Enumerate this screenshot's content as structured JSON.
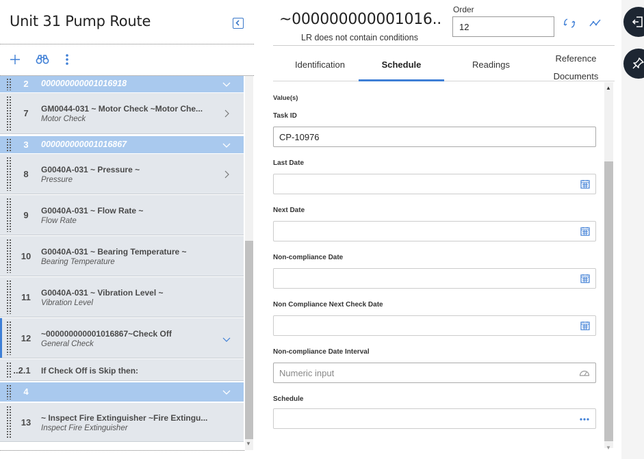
{
  "left": {
    "title": "Unit 31 Pump Route",
    "rows": [
      {
        "kind": "group",
        "num": "2",
        "text": "000000000001016918"
      },
      {
        "kind": "item",
        "num": "7",
        "title": "GM0044-031 ~ Motor Check ~Motor Che...",
        "subtitle": "Motor Check"
      },
      {
        "kind": "group",
        "num": "3",
        "text": "000000000001016867"
      },
      {
        "kind": "item",
        "num": "8",
        "title": "G0040A-031 ~ Pressure ~",
        "subtitle": "Pressure"
      },
      {
        "kind": "item",
        "num": "9",
        "title": "G0040A-031 ~ Flow Rate ~",
        "subtitle": "Flow Rate"
      },
      {
        "kind": "item",
        "num": "10",
        "title": "G0040A-031 ~ Bearing Temperature ~",
        "subtitle": "Bearing Temperature"
      },
      {
        "kind": "item",
        "num": "11",
        "title": "G0040A-031 ~ Vibration Level ~",
        "subtitle": "Vibration Level"
      },
      {
        "kind": "item",
        "num": "12",
        "title": "~000000000001016867~Check Off",
        "subtitle": "General Check"
      },
      {
        "kind": "plain",
        "num": "..2.1",
        "title": "If Check Off is Skip then:"
      },
      {
        "kind": "group",
        "num": "4",
        "text": ""
      },
      {
        "kind": "item",
        "num": "13",
        "title": "~ Inspect Fire Extinguisher ~Fire Extingu...",
        "subtitle": "Inspect Fire Extinguisher"
      }
    ]
  },
  "header": {
    "title": "~000000000001016..",
    "subtitle": "LR does not contain conditions",
    "order_label": "Order",
    "order_value": "12"
  },
  "tabs": {
    "identification": "Identification",
    "schedule": "Schedule",
    "readings": "Readings",
    "reference_line1": "Reference",
    "reference_line2": "Documents"
  },
  "form": {
    "section": "Value(s)",
    "task_id_label": "Task ID",
    "task_id_value": "CP-10976",
    "last_date_label": "Last Date",
    "next_date_label": "Next Date",
    "noncompliance_date_label": "Non-compliance Date",
    "noncompliance_next_label": "Non Compliance Next Check Date",
    "noncompliance_interval_label": "Non-compliance Date Interval",
    "noncompliance_interval_placeholder": "Numeric input",
    "schedule_label": "Schedule"
  },
  "colors": {
    "accent": "#3f7fd6",
    "group_row": "#a9c9ee",
    "item_row": "#e3e7ec",
    "side_button": "#1d2632"
  }
}
